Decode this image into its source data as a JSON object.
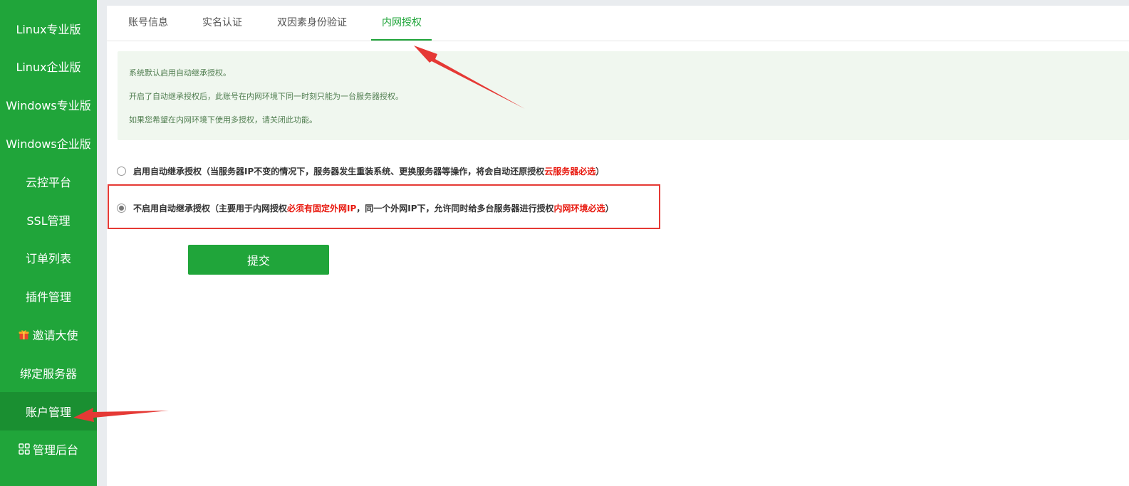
{
  "sidebar": {
    "items": [
      {
        "label": "Linux专业版"
      },
      {
        "label": "Linux企业版"
      },
      {
        "label": "Windows专业版"
      },
      {
        "label": "Windows企业版"
      },
      {
        "label": "云控平台"
      },
      {
        "label": "SSL管理"
      },
      {
        "label": "订单列表"
      },
      {
        "label": "插件管理"
      },
      {
        "label": "邀请大使",
        "icon": "gift-icon"
      },
      {
        "label": "绑定服务器"
      },
      {
        "label": "账户管理",
        "active": true
      },
      {
        "label": "管理后台",
        "icon": "grid-icon"
      }
    ]
  },
  "tabs": [
    {
      "label": "账号信息"
    },
    {
      "label": "实名认证"
    },
    {
      "label": "双因素身份验证"
    },
    {
      "label": "内网授权",
      "active": true
    }
  ],
  "notice": {
    "lines": [
      "系统默认启用自动继承授权。",
      "开启了自动继承授权后，此账号在内网环境下同一时刻只能为一台服务器授权。",
      "如果您希望在内网环境下使用多授权，请关闭此功能。"
    ]
  },
  "options": {
    "enable": {
      "text": "启用自动继承授权（当服务器IP不变的情况下，服务器发生重装系统、更换服务器等操作，将会自动还原授权 ",
      "red": "云服务器必选",
      "close": "）",
      "checked": false
    },
    "disable": {
      "text1": "不启用自动继承授权（主要用于内网授权 ",
      "red1": "必须有固定外网IP",
      "text2": "，同一个外网IP下，允许同时给多台服务器进行授权 ",
      "red2": "内网环境必选",
      "close": "）",
      "checked": true
    }
  },
  "submit": {
    "label": "提交"
  },
  "colors": {
    "brand": "#20a53a",
    "sidebar_active": "#1a8f31",
    "warning": "#e8190f",
    "annotation": "#e53935"
  }
}
